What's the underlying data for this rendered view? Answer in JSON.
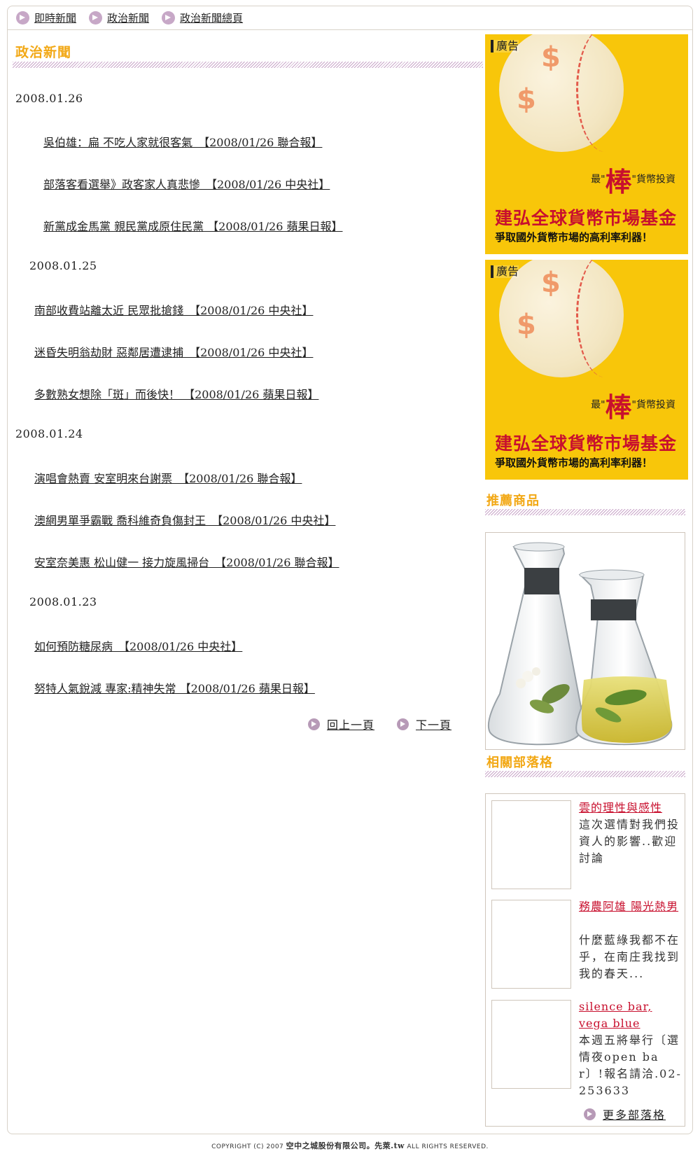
{
  "topnav": {
    "items": [
      {
        "label": "即時新聞"
      },
      {
        "label": "政治新聞"
      },
      {
        "label": "政治新聞總頁"
      }
    ]
  },
  "main": {
    "section_title": "政治新聞",
    "groups": [
      {
        "date": "2008.01.26",
        "items": [
          "吳伯雄：扁 不吃人家就很客氣　【2008/01/26 聯合報】",
          "部落客看選舉》政客家人真悲慘　【2008/01/26 中央社】",
          "新黨成金馬黨 親民黨成原住民黨 【2008/01/26 蘋果日報】"
        ]
      },
      {
        "date": "2008.01.25",
        "items": [
          "南部收費站離太近 民眾批搶錢　【2008/01/26 中央社】",
          "迷昏失明翁劫財 惡鄰居遭逮捕　【2008/01/26 中央社】",
          "多數熟女想除「斑」而後快！ 【2008/01/26 蘋果日報】"
        ]
      },
      {
        "date": "2008.01.24",
        "items": [
          "演唱會熱賣 安室明來台謝票　【2008/01/26 聯合報】",
          "澳網男單爭霸戰 喬科維奇負傷封王　【2008/01/26 中央社】",
          "安室奈美惠 松山健一 接力旋風掃台　【2008/01/26 聯合報】"
        ]
      },
      {
        "date": "2008.01.23",
        "items": [
          "如何預防糖尿病　【2008/01/26 中央社】",
          "努特人氣銳減 專家:精神失常 【2008/01/26 蘋果日報】"
        ]
      }
    ],
    "pager": {
      "prev": "回上一頁",
      "next": "下一頁"
    }
  },
  "ads": [
    {
      "tag": "廣告",
      "slogan_prefix": "最\"",
      "slogan_big": "棒",
      "slogan_suffix": "\"貨幣投資",
      "fund": "建弘全球貨幣市場基金",
      "sub": "爭取國外貨幣市場的高利率利器！"
    },
    {
      "tag": "廣告",
      "slogan_prefix": "最\"",
      "slogan_big": "棒",
      "slogan_suffix": "\"貨幣投資",
      "fund": "建弘全球貨幣市場基金",
      "sub": "爭取國外貨幣市場的高利率利器！"
    }
  ],
  "sidebar": {
    "recommend_title": "推薦商品",
    "blogs_title": "相關部落格",
    "blogs": [
      {
        "title": "雲的理性與感性",
        "desc": "這次選情對我們投資人的影響..歡迎討論"
      },
      {
        "title": "務農阿雄 陽光熱男",
        "desc": "什麼藍綠我都不在乎，在南庄我找到我的春天..."
      },
      {
        "title": "silence bar, vega blue",
        "desc": "本週五將舉行〔選情夜open bar〕!報名請洽.02-253633"
      }
    ],
    "more_label": "更多部落格"
  },
  "footer": {
    "prefix": "COPYRIGHT (C) 2007 ",
    "company": "空中之城股份有限公司。先萊.tw",
    "suffix": " ALL RIGHTS RESERVED."
  }
}
